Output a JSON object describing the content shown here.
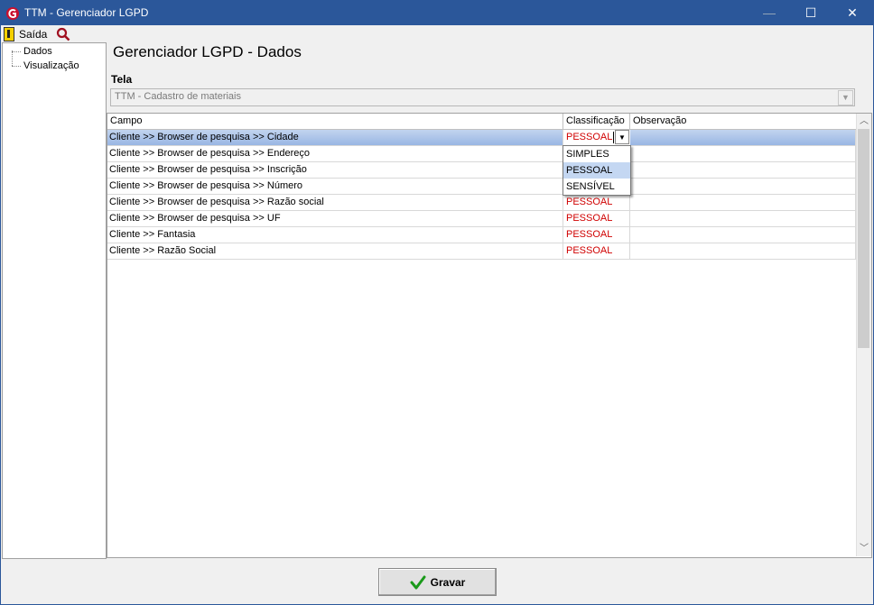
{
  "window": {
    "title": "TTM - Gerenciador LGPD",
    "controls": [
      "—",
      "☐",
      "✕"
    ]
  },
  "toolbar": {
    "exit_label": "Saída"
  },
  "tree": {
    "items": [
      "Dados",
      "Visualização"
    ]
  },
  "main": {
    "title": "Gerenciador LGPD - Dados",
    "tela_label": "Tela",
    "tela_value": "TTM - Cadastro de materiais"
  },
  "grid": {
    "columns": [
      "Campo",
      "Classificação",
      "Observação"
    ],
    "rows": [
      {
        "campo": "Cliente >> Browser de pesquisa >> Cidade",
        "classificacao": "PESSOAL",
        "observacao": ""
      },
      {
        "campo": "Cliente >> Browser de pesquisa >> Endereço",
        "classificacao": "",
        "observacao": ""
      },
      {
        "campo": "Cliente >> Browser de pesquisa >> Inscrição",
        "classificacao": "",
        "observacao": ""
      },
      {
        "campo": "Cliente >> Browser de pesquisa >> Número",
        "classificacao": "",
        "observacao": ""
      },
      {
        "campo": "Cliente >> Browser de pesquisa >> Razão social",
        "classificacao": "PESSOAL",
        "observacao": ""
      },
      {
        "campo": "Cliente >> Browser de pesquisa >> UF",
        "classificacao": "PESSOAL",
        "observacao": ""
      },
      {
        "campo": "Cliente >> Fantasia",
        "classificacao": "PESSOAL",
        "observacao": ""
      },
      {
        "campo": "Cliente >> Razão Social",
        "classificacao": "PESSOAL",
        "observacao": ""
      }
    ],
    "dropdown_options": [
      "SIMPLES",
      "PESSOAL",
      "SENSÍVEL"
    ],
    "dropdown_highlighted": "PESSOAL"
  },
  "footer": {
    "save_label": "Gravar"
  },
  "colors": {
    "titlebar": "#2b579a",
    "classification_text": "#d00000",
    "selected_row": "#99b6e3",
    "highlight": "#c4d7f2",
    "save_check": "#1a9a1a"
  },
  "icons": {
    "app": "ttm-logo-icon",
    "exit": "exit-door-icon",
    "search": "search-icon",
    "save": "check-icon"
  }
}
